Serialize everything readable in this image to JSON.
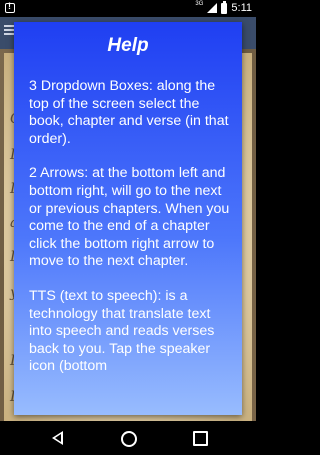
{
  "status_bar": {
    "signal_label": "3G",
    "time": "5:11"
  },
  "dialog": {
    "title": "Help",
    "paragraphs": [
      "3 Dropdown Boxes: along the top of the screen select the book, chapter and verse (in that order).",
      "2 Arrows: at the bottom left and bottom right, will go to the next or previous chapters. When you come to the end of a chapter click the bottom right arrow to move to the next chapter.",
      "TTS (text to speech): is a technology that translate text into speech and reads verses back to you. Tap the speaker icon (bottom"
    ]
  },
  "background": {
    "letters": [
      "Ge",
      "I",
      "I",
      "a",
      "I",
      "y",
      "I",
      "I"
    ]
  },
  "colors": {
    "dialog_top": "#1f3ff2",
    "dialog_bottom": "#98bcfe",
    "app_bar": "#3a4c6a",
    "parchment": "#ede0c2"
  },
  "icons": {
    "notification": "notification-icon",
    "signal": "signal-icon",
    "battery": "battery-icon",
    "menu": "menu-icon",
    "back": "back-icon",
    "home": "home-icon",
    "recent": "recent-apps-icon"
  }
}
